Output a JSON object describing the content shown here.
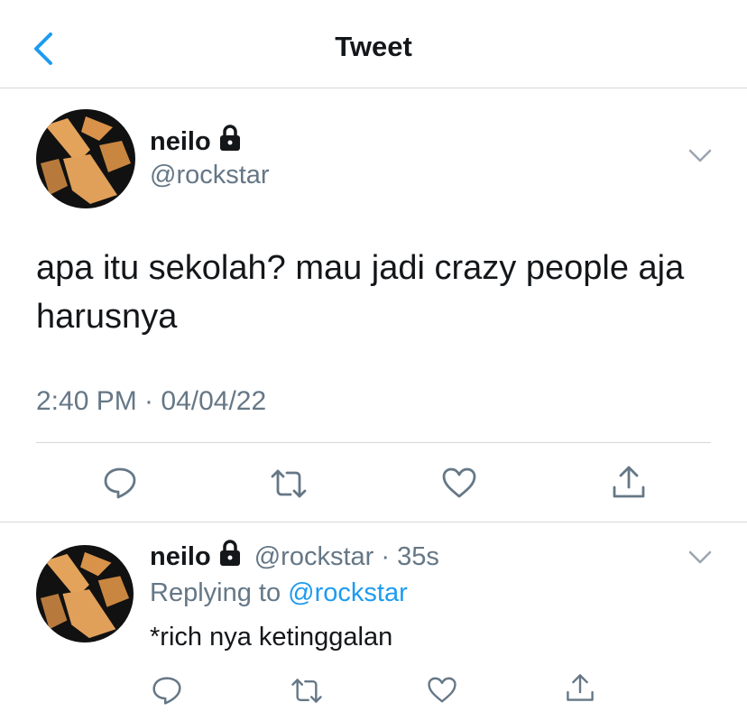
{
  "header": {
    "title": "Tweet",
    "back_icon": "chevron-left-icon"
  },
  "tweet": {
    "name": "neilo",
    "handle": "@rockstar",
    "text": "apa itu sekolah? mau jadi crazy people aja harusnya",
    "timestamp": "2:40 PM · 04/04/22"
  },
  "reply": {
    "name": "neilo",
    "handle": "@rockstar",
    "time": "· 35s",
    "replying_prefix": "Replying to",
    "replying_handle": "@rockstar",
    "text": "*rich nya ketinggalan"
  },
  "colors": {
    "accent": "#1d9bf0",
    "secondary_text": "#657786",
    "divider": "#d5d8db"
  },
  "icons": [
    "reply-icon",
    "retweet-icon",
    "like-icon",
    "share-icon",
    "lock-icon",
    "chevron-down-icon"
  ]
}
